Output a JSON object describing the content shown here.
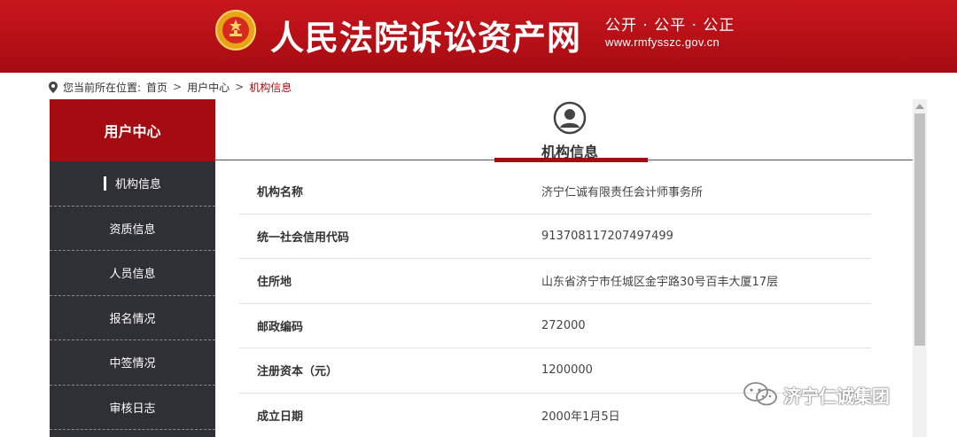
{
  "header": {
    "site_title": "人民法院诉讼资产网",
    "slogan": "公开 · 公平 · 公正",
    "url": "www.rmfysszc.gov.cn"
  },
  "breadcrumb": {
    "prefix": "您当前所在位置:",
    "home": "首页",
    "separator": ">",
    "user_center": "用户中心",
    "current": "机构信息"
  },
  "sidebar": {
    "title": "用户中心",
    "items": [
      {
        "label": "机构信息"
      },
      {
        "label": "资质信息"
      },
      {
        "label": "人员信息"
      },
      {
        "label": "报名情况"
      },
      {
        "label": "中签情况"
      },
      {
        "label": "审核日志"
      }
    ]
  },
  "main": {
    "title": "机构信息",
    "rows": [
      {
        "label": "机构名称",
        "value": "济宁仁诚有限责任会计师事务所"
      },
      {
        "label": "统一社会信用代码",
        "value": "913708117207497499"
      },
      {
        "label": "住所地",
        "value": "山东省济宁市任城区金宇路30号百丰大厦17层"
      },
      {
        "label": "邮政编码",
        "value": "272000"
      },
      {
        "label": "注册资本（元）",
        "value": "1200000"
      },
      {
        "label": "成立日期",
        "value": "2000年1月5日"
      }
    ]
  },
  "watermark": {
    "text": "济宁仁诚集团"
  },
  "colors": {
    "brand_red": "#a40c12",
    "sidebar_bg": "#2f2f36"
  }
}
